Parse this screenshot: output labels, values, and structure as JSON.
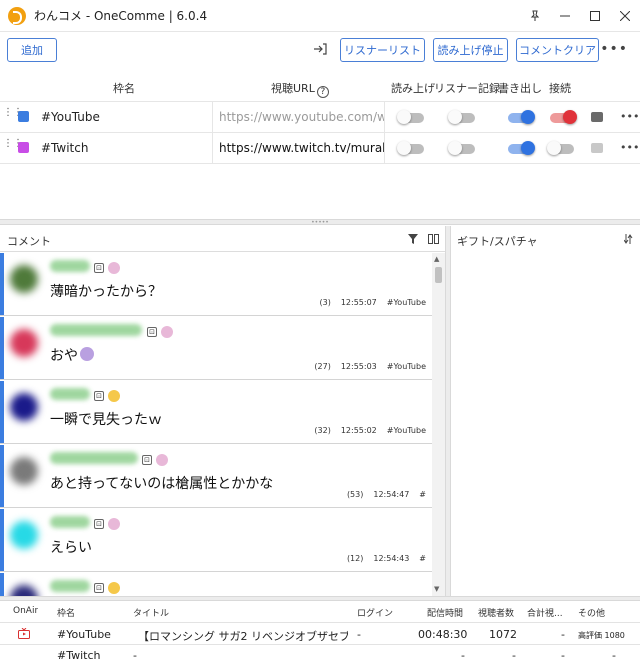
{
  "app": {
    "title": "わんコメ - OneComme | 6.0.4"
  },
  "toolbar": {
    "add_label": "追加",
    "listener_label": "リスナーリスト",
    "stop_reading_label": "読み上げ停止",
    "clear_label": "コメントクリア",
    "more_label": "•••"
  },
  "frames": {
    "headers": {
      "name": "枠名",
      "url": "視聴URL",
      "read": "読み上げ",
      "listener": "リスナー記録",
      "write": "書き出し",
      "connect": "接続"
    },
    "rows": [
      {
        "name": "#YouTube",
        "color": "#3b7de0",
        "url": "https://www.youtube.com/watch",
        "url_is_placeholder": true,
        "read": false,
        "listener": false,
        "write": true,
        "connect": true
      },
      {
        "name": "#Twitch",
        "color": "#c84de6",
        "url": "https://www.twitch.tv/murakami",
        "url_is_placeholder": false,
        "read": false,
        "listener": false,
        "write": true,
        "connect": false
      }
    ]
  },
  "comments_panel": {
    "title": "コメント"
  },
  "gifts_panel": {
    "title": "ギフト/スパチャ"
  },
  "comments": [
    {
      "text": "薄暗かったから？",
      "count": "(3)",
      "time": "12:55:07",
      "service": "#YouTube",
      "bar_color": "#3b7de0",
      "avatar_color": "#4f7a3a"
    },
    {
      "text": "おや",
      "count": "(27)",
      "time": "12:55:03",
      "service": "#YouTube",
      "bar_color": "#3b7de0",
      "avatar_color": "#d7385a"
    },
    {
      "text": "一瞬で見失ったｗ",
      "count": "(32)",
      "time": "12:55:02",
      "service": "#YouTube",
      "bar_color": "#3b7de0",
      "avatar_color": "#1a1a8a"
    },
    {
      "text": "あと持ってないのは槍属性とかかな",
      "count": "(53)",
      "time": "12:54:47",
      "service": "#",
      "bar_color": "#3b7de0",
      "avatar_color": "#7a7a7a"
    },
    {
      "text": "えらい",
      "count": "(12)",
      "time": "12:54:43",
      "service": "#",
      "bar_color": "#3b7de0",
      "avatar_color": "#27d9e6"
    },
    {
      "text": "",
      "count": "",
      "time": "",
      "service": "",
      "bar_color": "#3b7de0",
      "avatar_color": "#2a2a7a"
    }
  ],
  "status": {
    "headers": {
      "onair": "OnAir",
      "name": "枠名",
      "title": "タイトル",
      "login": "ログイン",
      "duration": "配信時間",
      "viewers": "視聴者数",
      "total": "合計視...",
      "other": "その他"
    },
    "rows": [
      {
        "name": "#YouTube",
        "title": "【ロマンシング サガ2 リベンジオブザセブン】",
        "login": "-",
        "duration": "00:48:30",
        "viewers": "1072",
        "total": "-",
        "other": "高評価 1080"
      },
      {
        "name": "#Twitch",
        "title": "-",
        "login": "",
        "duration": "-",
        "viewers": "-",
        "total": "-",
        "other": "-"
      }
    ]
  }
}
